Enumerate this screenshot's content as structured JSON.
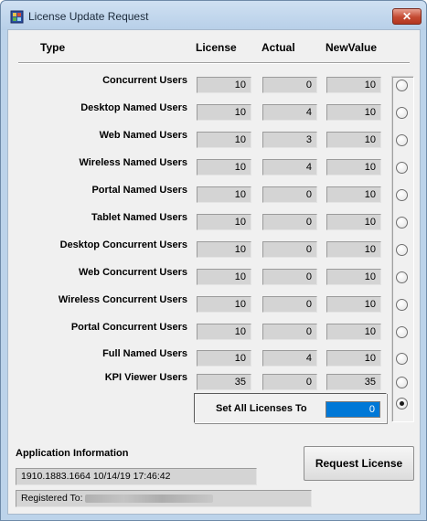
{
  "window": {
    "title": "License Update Request",
    "close_label": "✕"
  },
  "columns": {
    "type": "Type",
    "license": "License",
    "actual": "Actual",
    "new_value": "NewValue"
  },
  "rows": [
    {
      "label": "Concurrent Users",
      "license": "10",
      "actual": "0",
      "new_value": "10"
    },
    {
      "label": "Desktop Named Users",
      "license": "10",
      "actual": "4",
      "new_value": "10"
    },
    {
      "label": "Web Named Users",
      "license": "10",
      "actual": "3",
      "new_value": "10"
    },
    {
      "label": "Wireless Named Users",
      "license": "10",
      "actual": "4",
      "new_value": "10"
    },
    {
      "label": "Portal Named Users",
      "license": "10",
      "actual": "0",
      "new_value": "10"
    },
    {
      "label": "Tablet Named Users",
      "license": "10",
      "actual": "0",
      "new_value": "10"
    },
    {
      "label": "Desktop Concurrent Users",
      "license": "10",
      "actual": "0",
      "new_value": "10"
    },
    {
      "label": "Web Concurrent Users",
      "license": "10",
      "actual": "0",
      "new_value": "10"
    },
    {
      "label": "Wireless Concurrent Users",
      "license": "10",
      "actual": "0",
      "new_value": "10"
    },
    {
      "label": "Portal Concurrent Users",
      "license": "10",
      "actual": "0",
      "new_value": "10"
    },
    {
      "label": "Full Named Users",
      "license": "10",
      "actual": "4",
      "new_value": "10"
    },
    {
      "label": "KPI Viewer Users",
      "license": "35",
      "actual": "0",
      "new_value": "35"
    }
  ],
  "radio_selected_index": 12,
  "set_all": {
    "label": "Set All Licenses To",
    "value": "0"
  },
  "app_info": {
    "label": "Application Information",
    "version": "1910.1883.1664 10/14/19 17:46:42",
    "registered_label": "Registered To:"
  },
  "request_button": "Request License",
  "colors": {
    "title_bar": "#bcd3ea",
    "selection": "#0078d7",
    "close_button": "#c44a32"
  },
  "icons": {
    "app": "app-window-icon",
    "close": "close-icon"
  }
}
